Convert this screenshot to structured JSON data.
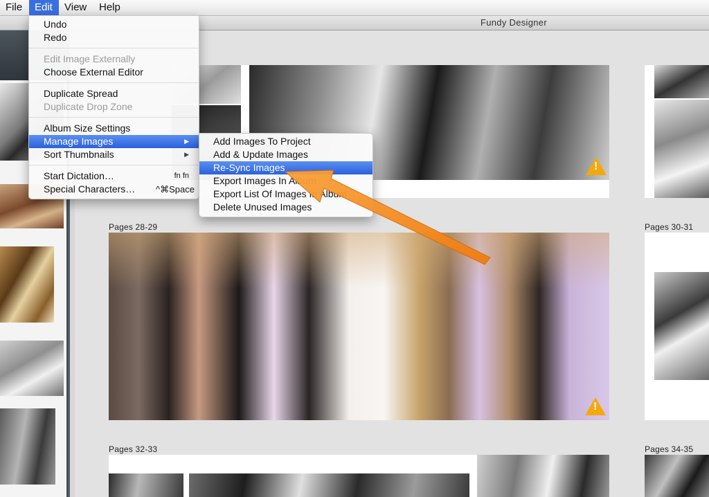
{
  "menubar": {
    "items": [
      {
        "label": "File"
      },
      {
        "label": "Edit"
      },
      {
        "label": "View"
      },
      {
        "label": "Help"
      }
    ]
  },
  "window": {
    "title": "Fundy Designer"
  },
  "edit_menu": {
    "items": [
      {
        "label": "Undo"
      },
      {
        "label": "Redo"
      },
      {
        "label": "Edit Image Externally",
        "disabled": true
      },
      {
        "label": "Choose External Editor"
      },
      {
        "label": "Duplicate Spread"
      },
      {
        "label": "Duplicate Drop Zone",
        "disabled": true
      },
      {
        "label": "Album Size Settings"
      },
      {
        "label": "Manage Images",
        "highlighted": true
      },
      {
        "label": "Sort Thumbnails"
      },
      {
        "label": "Start Dictation…",
        "shortcut": "fn fn"
      },
      {
        "label": "Special Characters…",
        "shortcut": "^⌘Space"
      }
    ]
  },
  "manage_images_submenu": {
    "items": [
      {
        "label": "Add Images To Project"
      },
      {
        "label": "Add & Update Images"
      },
      {
        "label": "Re-Sync Images",
        "highlighted": true
      },
      {
        "label": "Export Images In Album"
      },
      {
        "label": "Export List Of Images In Album"
      },
      {
        "label": "Delete Unused Images"
      }
    ]
  },
  "spreads": [
    {
      "label": "Pages 28-29"
    },
    {
      "label": "Pages 30-31"
    },
    {
      "label": "Pages 32-33"
    },
    {
      "label": "Pages 34-35"
    }
  ],
  "icons": {
    "warning": "warning-triangle-icon",
    "submenu_arrow": "▶"
  },
  "colors": {
    "highlight": "#2a61dc",
    "warning": "#f4a80c",
    "annotation_arrow": "#f5901e"
  }
}
